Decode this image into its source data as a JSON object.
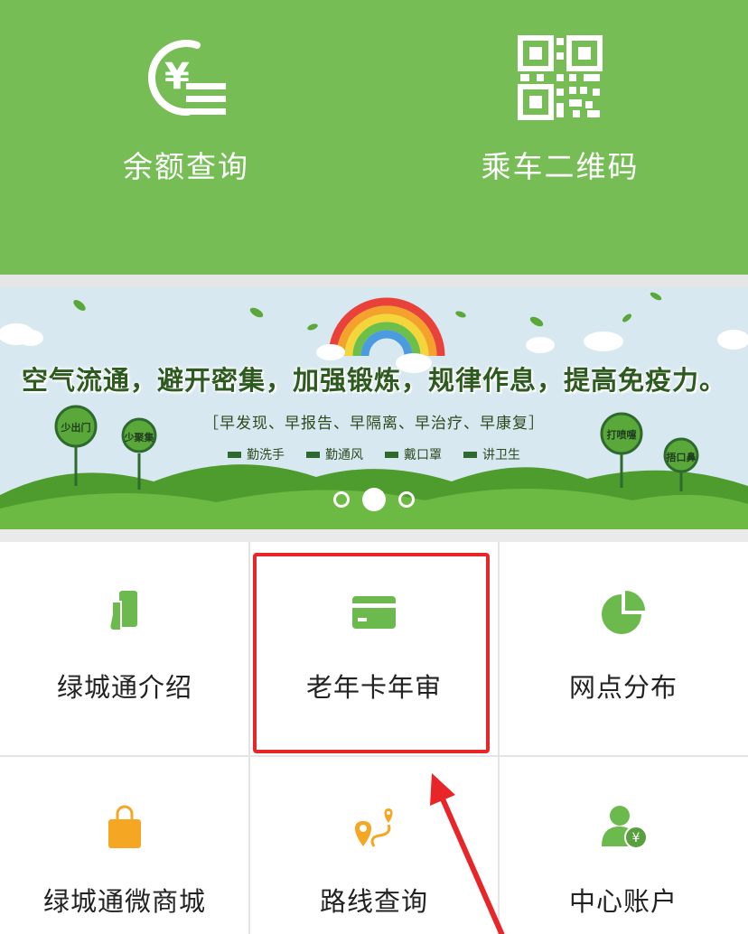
{
  "header": {
    "balance_label": "余额查询",
    "qr_label": "乘车二维码"
  },
  "banner": {
    "title": "空气流通，避开密集，加强锻炼，规律作息，提高免疫力。",
    "subtitle": "［早发现、早报告、早隔离、早治疗、早康复］",
    "tips": [
      "勤洗手",
      "勤通风",
      "戴口罩",
      "讲卫生"
    ],
    "signs": [
      "少出门",
      "少聚集",
      "打喷嚏",
      "捂口鼻"
    ],
    "active_slide": 2,
    "slide_count": 3
  },
  "grid": {
    "items": [
      {
        "label": "绿城通介绍",
        "icon": "card-hand-icon"
      },
      {
        "label": "老年卡年审",
        "icon": "credit-card-icon"
      },
      {
        "label": "网点分布",
        "icon": "pie-chart-icon"
      },
      {
        "label": "绿城通微商城",
        "icon": "shopping-bag-icon"
      },
      {
        "label": "路线查询",
        "icon": "route-pin-icon"
      },
      {
        "label": "中心账户",
        "icon": "user-yuan-icon"
      }
    ]
  },
  "colors": {
    "header_green": "#76bd55",
    "icon_green": "#6cb94d",
    "icon_orange": "#f5a623",
    "highlight_red": "#e8262a"
  }
}
